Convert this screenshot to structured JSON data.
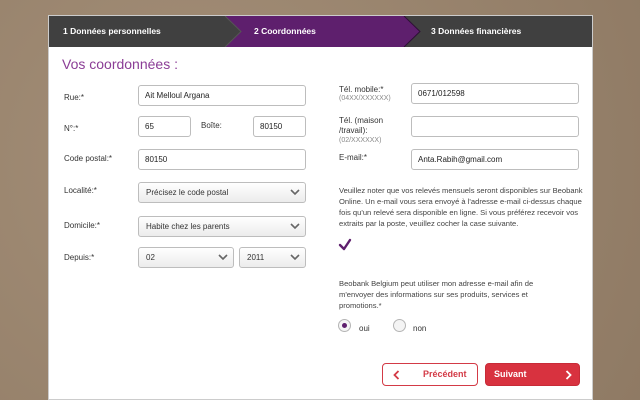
{
  "steps": [
    {
      "label": "1   Données personnelles",
      "active": false
    },
    {
      "label": "2   Coordonnées",
      "active": true
    },
    {
      "label": "3   Données financières",
      "active": false
    }
  ],
  "colors": {
    "accent": "#5e1f6d",
    "tab_dark": "#404040",
    "button_red": "#d8323f",
    "title": "#8b3d96"
  },
  "section_title": "Vos coordonnées :",
  "left": {
    "rue_label": "Rue:*",
    "rue_value": "Ait Melloul Argana",
    "numero_label": "N°:*",
    "numero_value": "65",
    "boite_label": "Boîte:",
    "boite_value": "80150",
    "code_postal_label": "Code postal:*",
    "code_postal_value": "80150",
    "localite_label": "Localité:*",
    "localite_value": "Précisez le code postal",
    "domicile_label": "Domicile:*",
    "domicile_value": "Habite chez les parents",
    "depuis_label": "Depuis:*",
    "depuis_month": "02",
    "depuis_year": "2011"
  },
  "right": {
    "mobile_label": "Tél. mobile:*",
    "mobile_hint": "(04XX/XXXXXX)",
    "mobile_value": "0671/012598",
    "maison_label_1": "Tél. (maison",
    "maison_label_2": "/travail):",
    "maison_hint": "(02/XXXXXX)",
    "maison_value": "",
    "email_label": "E-mail:*",
    "email_value": "Anta.Rabih@gmail.com",
    "releves_note": "Veuillez noter que vos relevés mensuels seront disponibles sur Beobank Online. Un e-mail vous sera envoyé à l'adresse e-mail ci-dessus chaque fois qu'un relevé sera disponible en ligne. Si vous préférez recevoir vos extraits par la poste, veuillez cocher la case suivante.",
    "releves_checked": true,
    "consent_note": "Beobank Belgium peut utiliser mon adresse e-mail afin de m'envoyer des informations sur ses produits, services et promotions.*",
    "oui_label": "oui",
    "non_label": "non",
    "consent_selected": "oui"
  },
  "buttons": {
    "previous": "Précédent",
    "next": "Suivant"
  },
  "icons": {
    "checkmark": "check-icon",
    "left": "chevron-left-icon",
    "right": "chevron-right-icon",
    "dropdown": "chevron-down-icon"
  }
}
